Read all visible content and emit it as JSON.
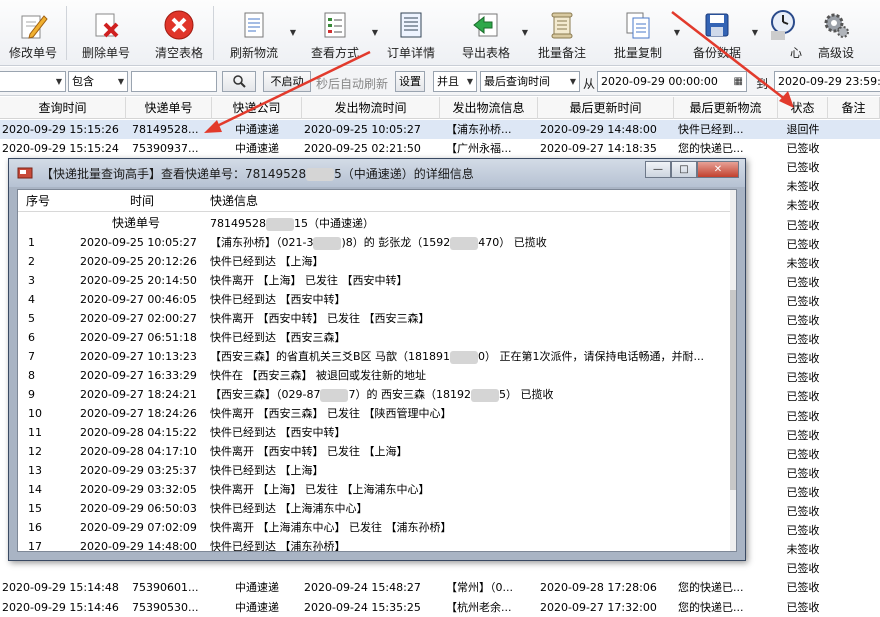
{
  "toolbar": {
    "buttons": [
      {
        "label": "修改单号",
        "icon": "edit-pencil-icon"
      },
      {
        "label": "删除单号",
        "icon": "delete-doc-icon"
      },
      {
        "label": "清空表格",
        "icon": "clear-icon"
      },
      {
        "label": "刷新物流",
        "icon": "refresh-doc-icon"
      },
      {
        "label": "查看方式",
        "icon": "view-list-icon"
      },
      {
        "label": "订单详情",
        "icon": "order-detail-icon"
      },
      {
        "label": "导出表格",
        "icon": "export-icon"
      },
      {
        "label": "批量备注",
        "icon": "scroll-note-icon"
      },
      {
        "label": "批量复制",
        "icon": "copy-doc-icon"
      },
      {
        "label": "备份数据",
        "icon": "save-disk-icon"
      },
      {
        "label": "心",
        "icon": "clock-person-icon"
      },
      {
        "label": "高级设",
        "icon": "gear-icon"
      }
    ]
  },
  "filter": {
    "contains": "包含",
    "autorun_button": "不启动",
    "autorun_label": "秒后自动刷新",
    "settings_button": "设置",
    "logic": "并且",
    "field": "最后查询时间",
    "from_label": "从",
    "from_value": "2020-09-29 00:00:00",
    "to_label": "到",
    "to_value": "2020-09-29 23:59:"
  },
  "grid": {
    "headers": [
      "查询时间",
      "快递单号",
      "快递公司",
      "发出物流时间",
      "发出物流信息",
      "最后更新时间",
      "最后更新物流",
      "状态",
      "备注"
    ],
    "rows": [
      [
        "2020-09-29 15:15:26",
        "78149528...",
        "中通速递",
        "2020-09-25 10:05:27",
        "【浦东孙桥...",
        "2020-09-29 14:48:00",
        "快件已经到...",
        "退回件"
      ],
      [
        "2020-09-29 15:15:24",
        "75390937...",
        "中通速递",
        "2020-09-25 02:21:50",
        "【广州永福...",
        "2020-09-27 14:18:35",
        "您的快递已...",
        "已签收"
      ],
      [
        "",
        "",
        "",
        "",
        "",
        "",
        "",
        "已签收"
      ],
      [
        "",
        "",
        "",
        "",
        "",
        "",
        "",
        "未签收"
      ],
      [
        "",
        "",
        "",
        "",
        "",
        "",
        "",
        "未签收"
      ],
      [
        "",
        "",
        "",
        "",
        "",
        "",
        "",
        "已签收"
      ],
      [
        "",
        "",
        "",
        "",
        "",
        "",
        "",
        "已签收"
      ],
      [
        "",
        "",
        "",
        "",
        "",
        "",
        "",
        "未签收"
      ],
      [
        "",
        "",
        "",
        "",
        "",
        "",
        "",
        "已签收"
      ],
      [
        "",
        "",
        "",
        "",
        "",
        "",
        "",
        "已签收"
      ],
      [
        "",
        "",
        "",
        "",
        "",
        "",
        "",
        "已签收"
      ],
      [
        "",
        "",
        "",
        "",
        "",
        "",
        "",
        "已签收"
      ],
      [
        "",
        "",
        "",
        "",
        "",
        "",
        "",
        "已签收"
      ],
      [
        "",
        "",
        "",
        "",
        "",
        "",
        "",
        "已签收"
      ],
      [
        "",
        "",
        "",
        "",
        "",
        "",
        "",
        "已签收"
      ],
      [
        "",
        "",
        "",
        "",
        "",
        "",
        "",
        "已签收"
      ],
      [
        "",
        "",
        "",
        "",
        "",
        "",
        "",
        "已签收"
      ],
      [
        "",
        "",
        "",
        "",
        "",
        "",
        "",
        "已签收"
      ],
      [
        "",
        "",
        "",
        "",
        "",
        "",
        "",
        "已签收"
      ],
      [
        "",
        "",
        "",
        "",
        "",
        "",
        "",
        "已签收"
      ],
      [
        "",
        "",
        "",
        "",
        "",
        "",
        "",
        "已签收"
      ],
      [
        "",
        "",
        "",
        "",
        "",
        "",
        "",
        "已签收"
      ],
      [
        "",
        "",
        "",
        "",
        "",
        "",
        "",
        "未签收"
      ],
      [
        "",
        "",
        "",
        "",
        "",
        "",
        "",
        "已签收"
      ],
      [
        "2020-09-29 15:14:48",
        "75390601...",
        "中通速递",
        "2020-09-24 15:48:27",
        "【常州】（0...",
        "2020-09-28 17:28:06",
        "您的快递已...",
        "已签收"
      ],
      [
        "2020-09-29 15:14:46",
        "75390530...",
        "中通速递",
        "2020-09-24 15:35:25",
        "【杭州老余...",
        "2020-09-27 17:32:00",
        "您的快递已...",
        "已签收"
      ]
    ]
  },
  "dialog": {
    "title": "【快递批量查询高手】查看快递单号：78149528",
    "title_tail": "5（中通速递）的详细信息",
    "min": "—",
    "max": "□",
    "close": "✕",
    "headers": [
      "序号",
      "时间",
      "快递信息"
    ],
    "tracking_label": "快递单号",
    "tracking_value": "78149528",
    "tracking_tail": "15（中通速递）",
    "rows": [
      [
        "1",
        "2020-09-25 10:05:27",
        "【浦东孙桥】（021-3",
        ")8）的 彭张龙（1592",
        "470） 已揽收"
      ],
      [
        "2",
        "2020-09-25 20:12:26",
        "快件已经到达 【上海】"
      ],
      [
        "3",
        "2020-09-25 20:14:50",
        "快件离开 【上海】 已发往 【西安中转】"
      ],
      [
        "4",
        "2020-09-27 00:46:05",
        "快件已经到达 【西安中转】"
      ],
      [
        "5",
        "2020-09-27 02:00:27",
        "快件离开 【西安中转】 已发往 【西安三森】"
      ],
      [
        "6",
        "2020-09-27 06:51:18",
        "快件已经到达 【西安三森】"
      ],
      [
        "7",
        "2020-09-27 10:13:23",
        "【西安三森】的省直机关三爻B区 马歆（181891",
        "0） 正在第1次派件，请保持电话畅通，并耐..."
      ],
      [
        "8",
        "2020-09-27 16:33:29",
        "快件在 【西安三森】 被退回或发往新的地址"
      ],
      [
        "9",
        "2020-09-27 18:24:21",
        "【西安三森】（029-87",
        "7）的 西安三森（18192",
        "5） 已揽收"
      ],
      [
        "10",
        "2020-09-27 18:24:26",
        "快件离开 【西安三森】 已发往 【陕西管理中心】"
      ],
      [
        "11",
        "2020-09-28 04:15:22",
        "快件已经到达 【西安中转】"
      ],
      [
        "12",
        "2020-09-28 04:17:10",
        "快件离开 【西安中转】 已发往 【上海】"
      ],
      [
        "13",
        "2020-09-29 03:25:37",
        "快件已经到达 【上海】"
      ],
      [
        "14",
        "2020-09-29 03:32:05",
        "快件离开 【上海】 已发往 【上海浦东中心】"
      ],
      [
        "15",
        "2020-09-29 06:50:03",
        "快件已经到达 【上海浦东中心】"
      ],
      [
        "16",
        "2020-09-29 07:02:09",
        "快件离开 【上海浦东中心】 已发往 【浦东孙桥】"
      ],
      [
        "17",
        "2020-09-29 14:48:00",
        "快件已经到达 【浦东孙桥】"
      ]
    ]
  },
  "colors": {
    "accent_red": "#e23a2c",
    "status_blue": "#2040a0"
  }
}
